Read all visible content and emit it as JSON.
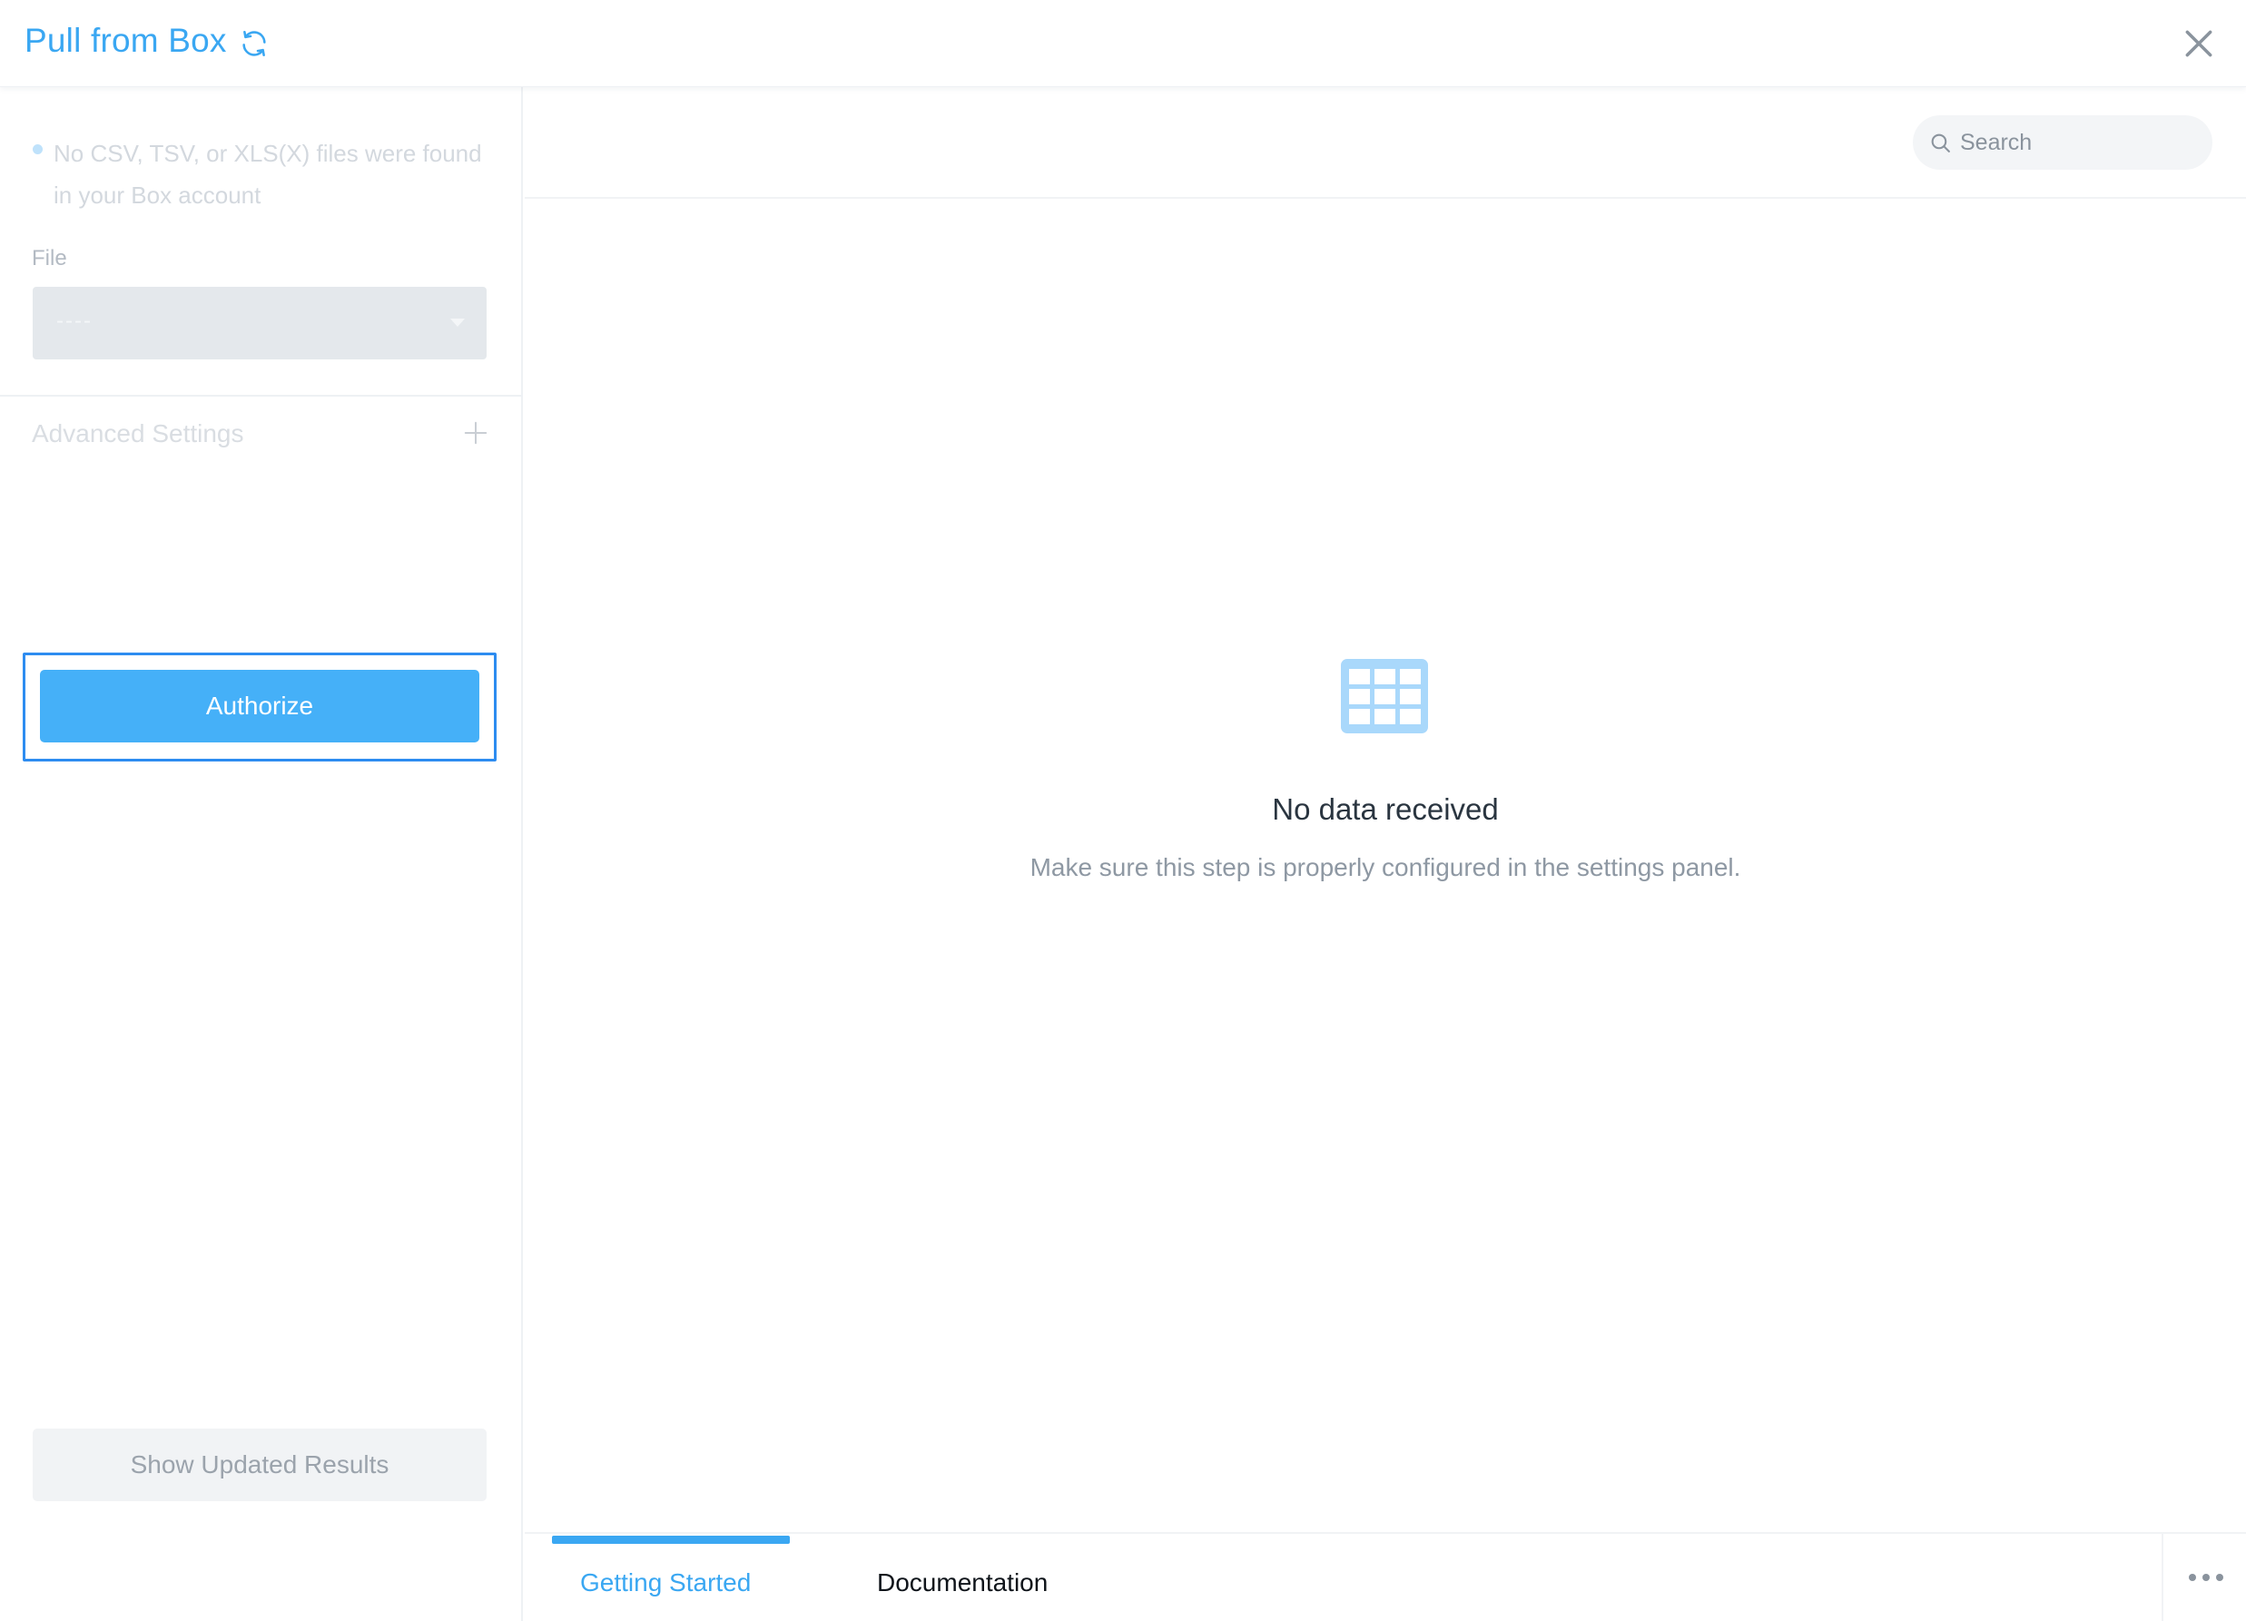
{
  "header": {
    "title": "Pull from Box",
    "refresh_icon": "refresh-icon",
    "close_icon": "close-icon"
  },
  "sidebar": {
    "notice": "No CSV, TSV, or XLS(X) files were found in your Box account",
    "file_label": "File",
    "file_select_value": "----",
    "advanced_settings_label": "Advanced Settings",
    "authorize_label": "Authorize",
    "show_results_label": "Show Updated Results"
  },
  "main": {
    "search_placeholder": "Search",
    "empty_title": "No data received",
    "empty_subtitle": "Make sure this step is properly configured in the settings panel."
  },
  "tabs": [
    {
      "label": "Getting Started",
      "active": true
    },
    {
      "label": "Documentation",
      "active": false
    }
  ],
  "colors": {
    "accent": "#3aa7f2",
    "authorize_button": "#45b0f8",
    "focus_outline": "#2d8cf0"
  }
}
